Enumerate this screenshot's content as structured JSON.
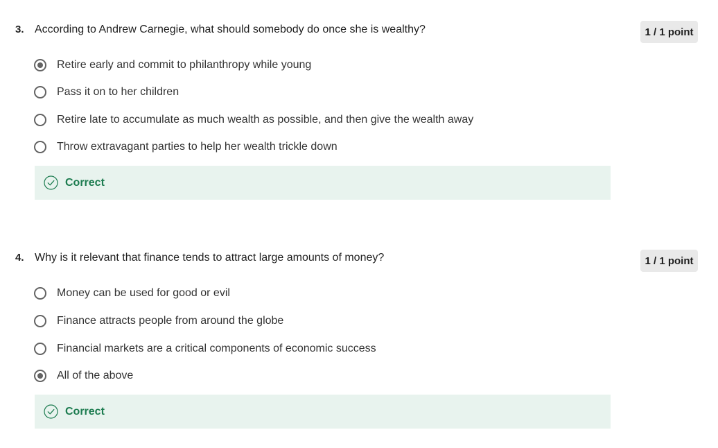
{
  "questions": [
    {
      "number": "3.",
      "text": "According to Andrew Carnegie, what should somebody do once she is wealthy?",
      "points": "1 / 1 point",
      "options": [
        {
          "label": "Retire early and commit to philanthropy while young",
          "selected": true
        },
        {
          "label": "Pass it on to her children",
          "selected": false
        },
        {
          "label": "Retire late to accumulate as much wealth as possible, and then give the wealth away",
          "selected": false
        },
        {
          "label": "Throw extravagant parties to help her wealth trickle down",
          "selected": false
        }
      ],
      "feedback": {
        "label": "Correct",
        "icon": "check-circle-icon"
      }
    },
    {
      "number": "4.",
      "text": "Why is it relevant that finance tends to attract large amounts of money?",
      "points": "1 / 1 point",
      "options": [
        {
          "label": "Money can be used for good or evil",
          "selected": false
        },
        {
          "label": "Finance attracts people from around the globe",
          "selected": false
        },
        {
          "label": "Financial markets are a critical components of economic success",
          "selected": false
        },
        {
          "label": "All of the above",
          "selected": true
        }
      ],
      "feedback": {
        "label": "Correct",
        "icon": "check-circle-icon"
      }
    }
  ],
  "colors": {
    "correct_text": "#1d7c50",
    "correct_bg": "#e8f3ee",
    "points_bg": "#e9e9e9",
    "radio": "#636363"
  }
}
